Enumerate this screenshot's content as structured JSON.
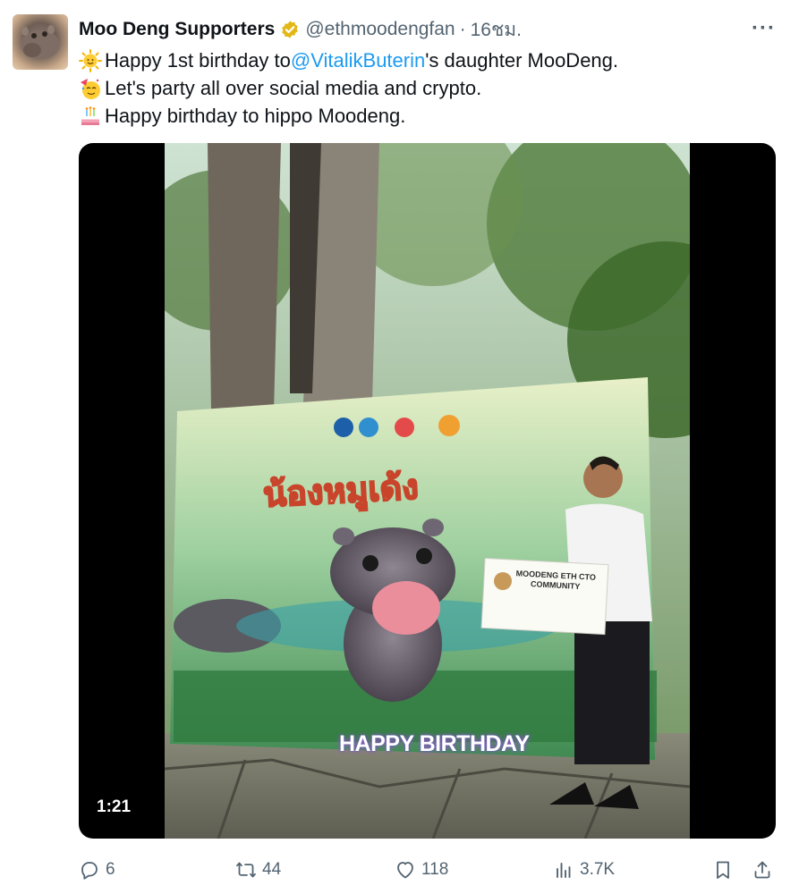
{
  "tweet": {
    "author_name": "Moo Deng Supporters",
    "handle": "@ethmoodengfan",
    "time": "16ชม.",
    "lines": [
      {
        "emoji": "sun-smile-emoji",
        "parts": [
          "Happy 1st birthday to ",
          "@VitalikButerin",
          "'s daughter MooDeng."
        ]
      },
      {
        "emoji": "party-face-emoji",
        "text": "Let's party all over social media and crypto."
      },
      {
        "emoji": "birthday-cake-emoji",
        "text": "Happy birthday to hippo Moodeng."
      }
    ]
  },
  "media": {
    "duration": "1:21",
    "banner_thai_title": "น้องหมูเด้ง",
    "banner_bottom_text": "HAPPY BIRTHDAY",
    "sign_line1": "MOODENG ETH CTO",
    "sign_line2": "COMMUNITY"
  },
  "actions": {
    "replies": "6",
    "reposts": "44",
    "likes": "118",
    "views": "3.7K"
  },
  "colors": {
    "link": "#1d9bf0",
    "muted": "#536471",
    "verified_gold": "#e2b719"
  }
}
